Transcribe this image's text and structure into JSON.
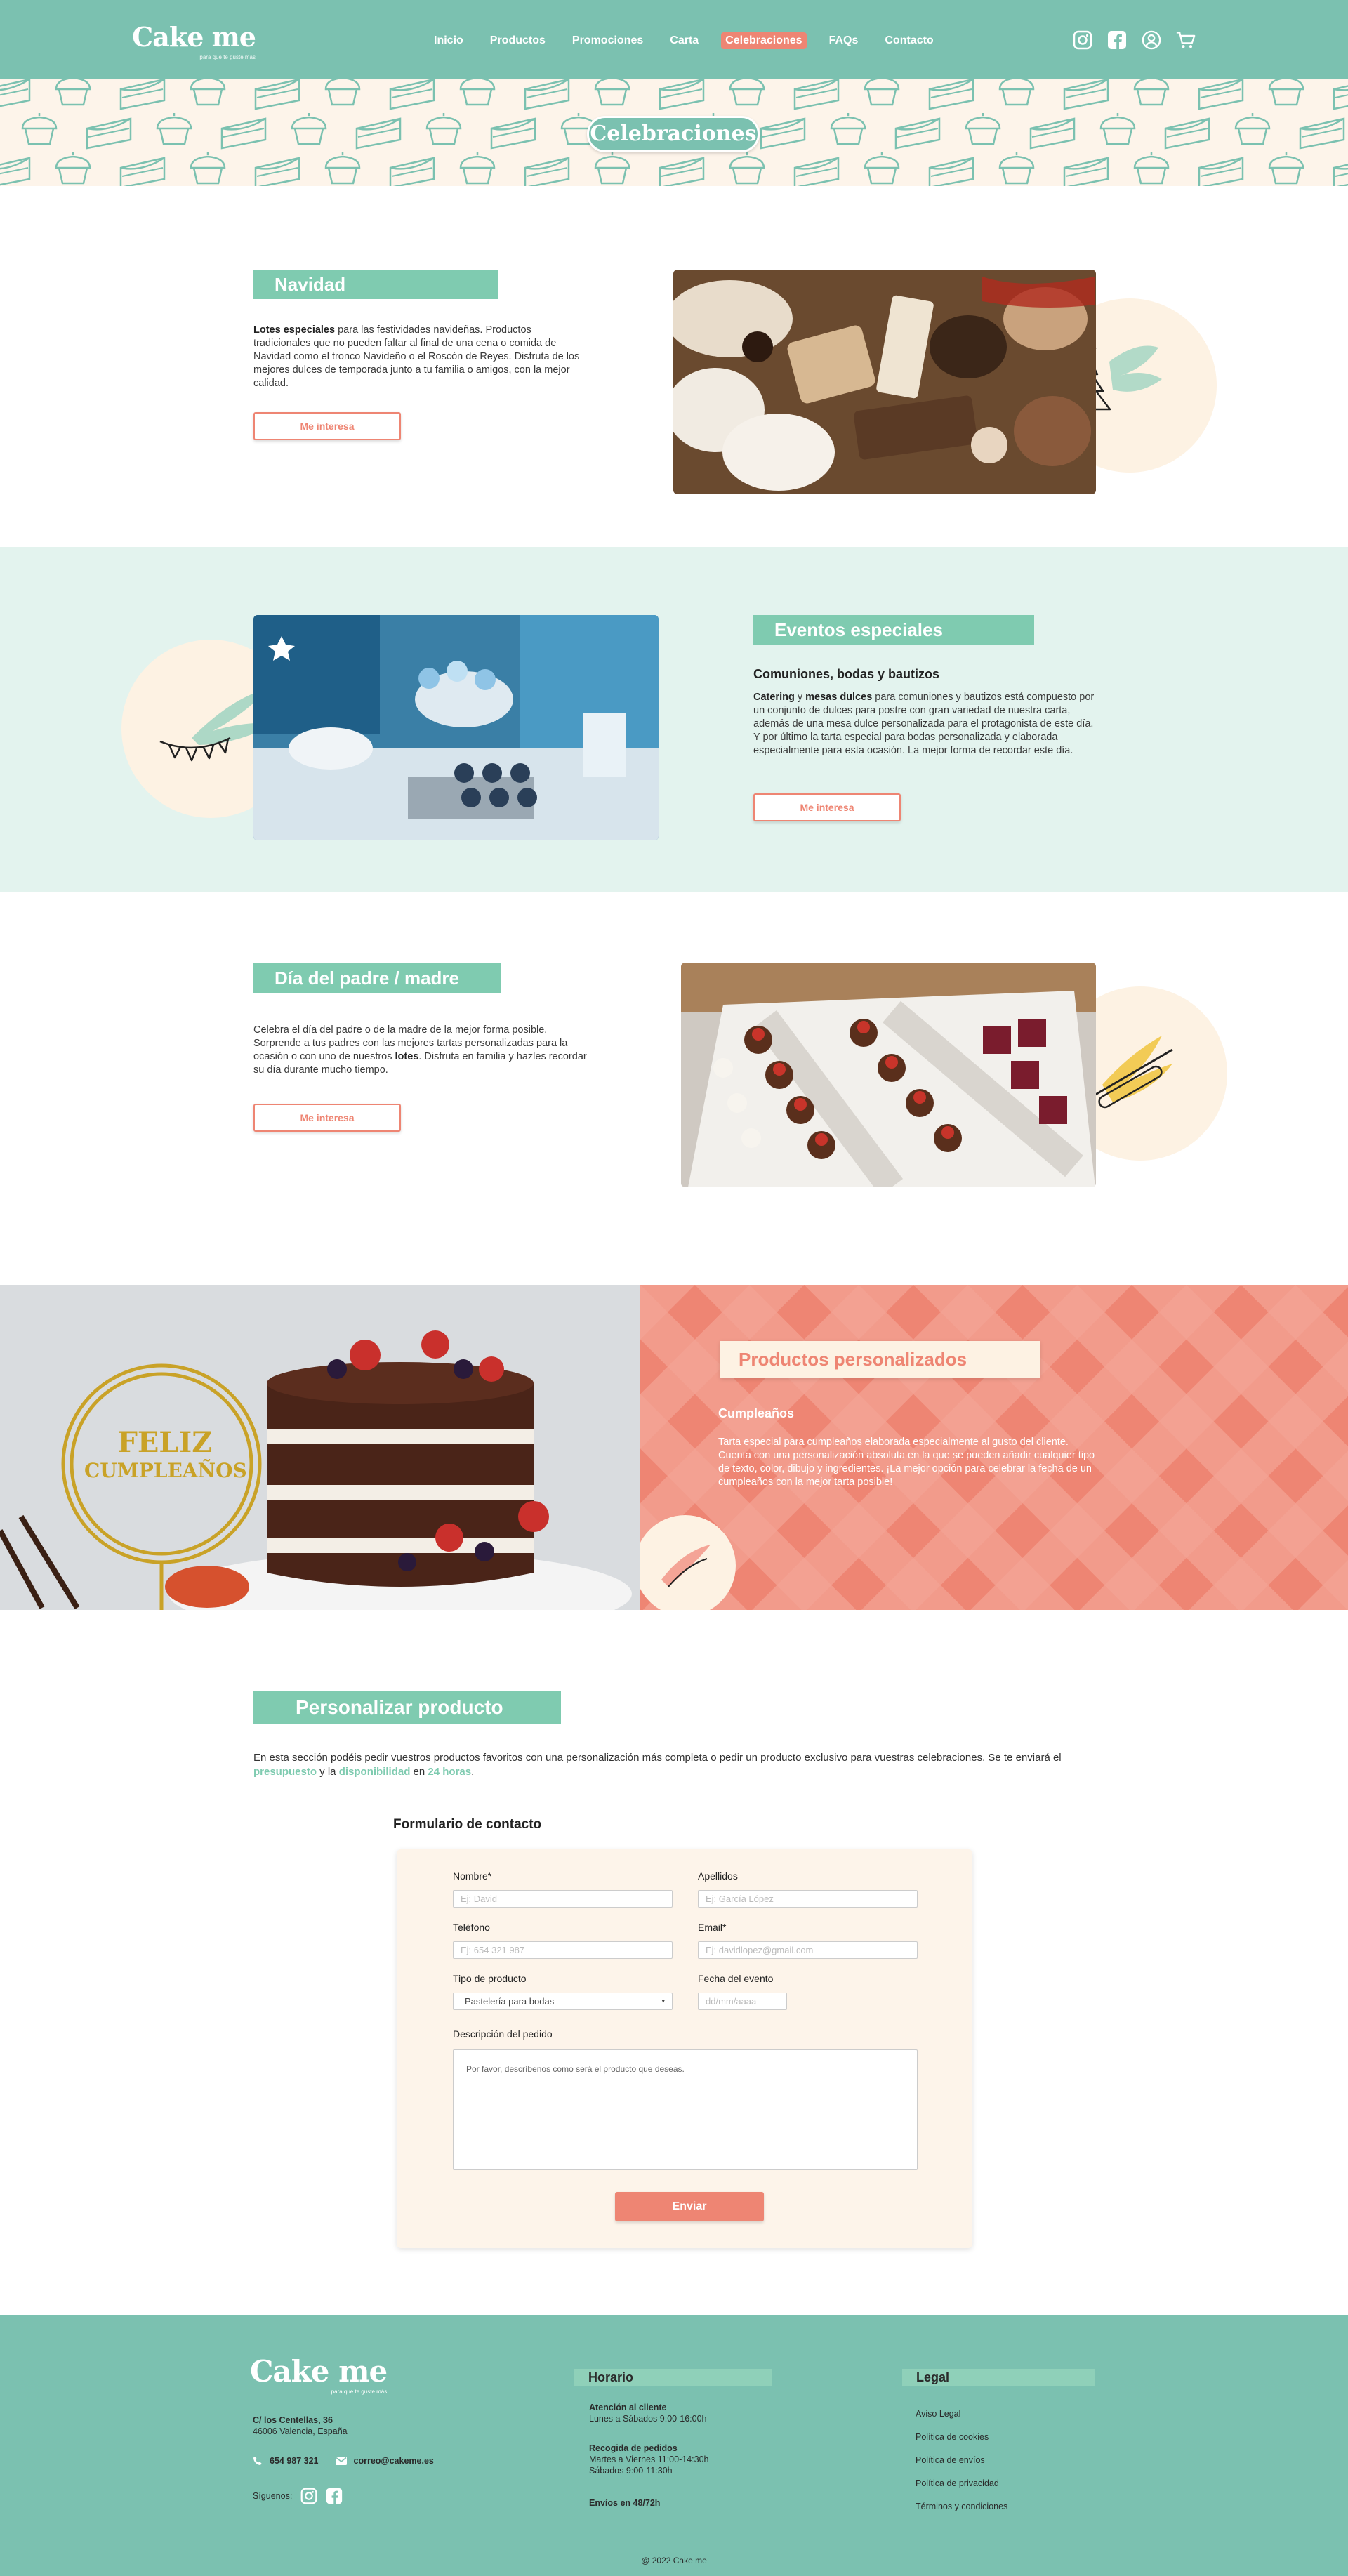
{
  "header": {
    "logo": "Cake me",
    "logo_tagline": "para que te guste más",
    "nav": [
      "Inicio",
      "Productos",
      "Promociones",
      "Carta",
      "Celebraciones",
      "FAQs",
      "Contacto"
    ],
    "active_nav": "Celebraciones",
    "icons": [
      "instagram-icon",
      "facebook-icon",
      "user-icon",
      "cart-icon"
    ]
  },
  "banner": {
    "title": "Celebraciones"
  },
  "navidad": {
    "title": "Navidad",
    "text_bold": "Lotes especiales",
    "text_rest": " para las festividades navideñas. Productos tradicionales que no pueden faltar al final de una cena o comida de Navidad como el tronco Navideño o el Roscón de Reyes. Disfruta de los mejores dulces de temporada junto a tu familia o amigos, con la mejor calidad.",
    "button": "Me interesa"
  },
  "eventos": {
    "title": "Eventos especiales",
    "subtitle": "Comuniones, bodas y bautizos",
    "bold1": "Catering",
    "mid1": " y ",
    "bold2": "mesas dulces",
    "text_rest": " para comuniones y bautizos está compuesto por un conjunto de dulces para postre con gran variedad de nuestra carta, además de una mesa dulce personalizada para el protagonista de este día. Y por último la tarta especial para bodas personalizada y elaborada especialmente para esta ocasión. La mejor forma de recordar este día.",
    "button": "Me interesa"
  },
  "padre": {
    "title": "Día del padre / madre",
    "text_a": "Celebra el día del padre o de la madre de la mejor forma posible. Sorprende a tus padres con las mejores tartas personalizadas para la ocasión o con uno de nuestros ",
    "text_bold": "lotes",
    "text_b": ". Disfruta en familia y hazles recordar su día durante mucho tiempo.",
    "button": "Me interesa"
  },
  "personalizados": {
    "title": "Productos personalizados",
    "subtitle": "Cumpleaños",
    "text": "Tarta especial para cumpleaños elaborada especialmente al gusto del cliente. Cuenta con una personalización absoluta en la que se pueden añadir cualquier tipo de texto, color, dibujo y ingredientes. ¡La mejor opción para celebrar la fecha de un cumpleaños con la mejor tarta posible!",
    "topper_line1": "FELIZ",
    "topper_line2": "CUMPLEAÑOS"
  },
  "personalizar": {
    "title": "Personalizar producto",
    "intro_a": "En esta sección podéis pedir vuestros productos favoritos con una personalización más completa o pedir un producto exclusivo para vuestras celebraciones. Se te enviará el ",
    "intro_b1": "presupuesto",
    "intro_y": " y la ",
    "intro_b2": "disponibilidad",
    "intro_en": " en ",
    "intro_b3": "24 horas",
    "intro_end": "."
  },
  "form": {
    "title": "Formulario de contacto",
    "nombre_label": "Nombre*",
    "nombre_ph": "Ej: David",
    "apellidos_label": "Apellidos",
    "apellidos_ph": "Ej: García López",
    "telefono_label": "Teléfono",
    "telefono_ph": "Ej: 654 321 987",
    "email_label": "Email*",
    "email_ph": "Ej: davidlopez@gmail.com",
    "tipo_label": "Tipo de producto",
    "tipo_value": "Pastelería para bodas",
    "fecha_label": "Fecha del evento",
    "fecha_ph": "dd/mm/aaaa",
    "desc_label": "Descripción del pedido",
    "desc_ph": "Por favor, descríbenos como será el producto que deseas.",
    "submit": "Enviar"
  },
  "footer": {
    "logo": "Cake me",
    "logo_tagline": "para que te guste más",
    "address1": "C/ los Centellas, 36",
    "address2": "46006 Valencia, España",
    "phone": "654 987 321",
    "email": "correo@cakeme.es",
    "follow": "Síguenos:",
    "horario_title": "Horario",
    "atencion_title": "Atención al cliente",
    "atencion_hours": "Lunes a Sábados 9:00-16:00h",
    "recogida_title": "Recogida de pedidos",
    "recogida_line1": "Martes a Viernes 11:00-14:30h",
    "recogida_line2": "Sábados 9:00-11:30h",
    "envios": "Envíos en 48/72h",
    "legal_title": "Legal",
    "legal_links": [
      "Aviso Legal",
      "Política de cookies",
      "Política de envíos",
      "Política de privacidad",
      "Términos y condiciones"
    ],
    "copyright": "@ 2022 Cake me"
  },
  "colors": {
    "teal": "#7bc1b0",
    "mint": "#7fcbb0",
    "coral": "#ee8573",
    "cream": "#fdf4ea",
    "mint_bg": "#e3f3ee"
  }
}
